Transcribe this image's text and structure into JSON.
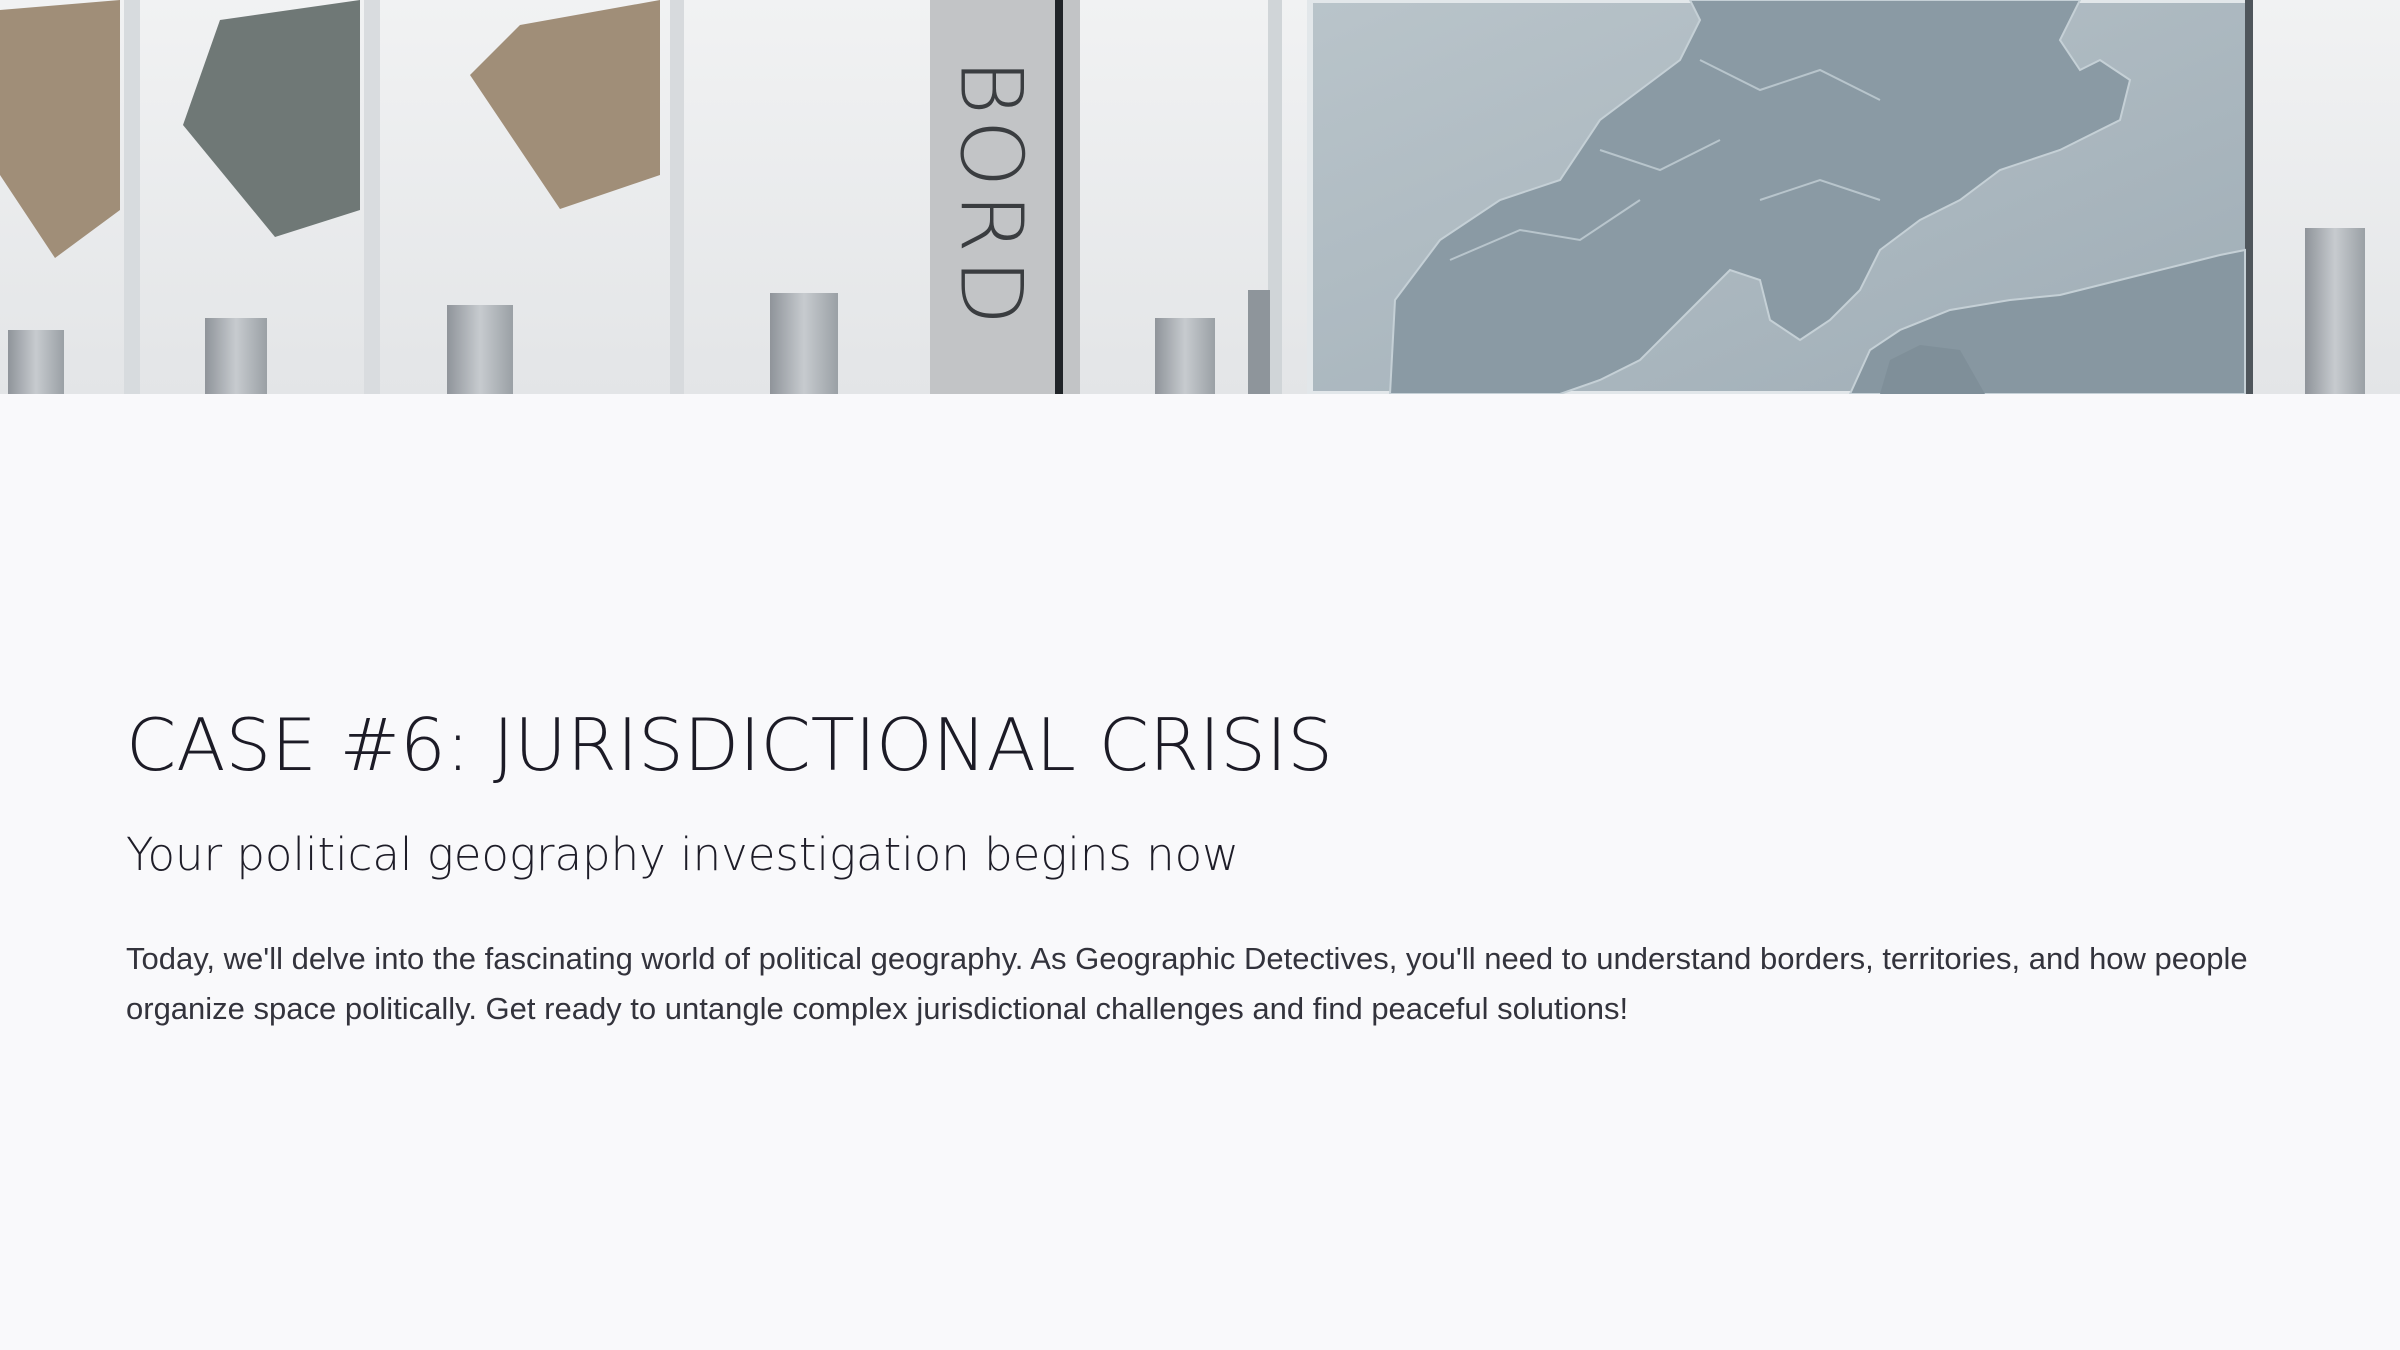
{
  "hero": {
    "sign_text": "BORD",
    "colors": {
      "flag_tan": "#a08e78",
      "flag_slate": "#6f7876",
      "map_land": "#8a9aa4",
      "map_sea": "#c9d3d8"
    }
  },
  "slide": {
    "title": "CASE #6: JURISDICTIONAL CRISIS",
    "subtitle": "Your political geography investigation begins now",
    "body": "Today, we'll delve into the fascinating world of political geography. As Geographic Detectives, you'll need to understand borders, territories, and how people organize space politically. Get ready to untangle complex jurisdictional challenges and find peaceful solutions!"
  },
  "colors": {
    "background": "#f9f9fb",
    "heading": "#1c1b26",
    "body": "#33333c"
  }
}
